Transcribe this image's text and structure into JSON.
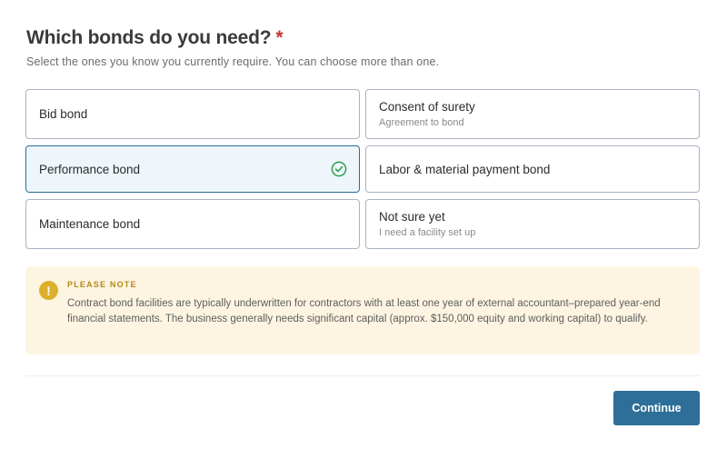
{
  "question": {
    "title": "Which bonds do you need?",
    "required_mark": "*",
    "subtitle": "Select the ones you know you currently require. You can choose more than one."
  },
  "options": [
    {
      "label": "Bid bond",
      "sub": "",
      "selected": false
    },
    {
      "label": "Consent of surety",
      "sub": "Agreement to bond",
      "selected": false
    },
    {
      "label": "Performance bond",
      "sub": "",
      "selected": true
    },
    {
      "label": "Labor & material payment bond",
      "sub": "",
      "selected": false
    },
    {
      "label": "Maintenance bond",
      "sub": "",
      "selected": false
    },
    {
      "label": "Not sure yet",
      "sub": "I need a facility set up",
      "selected": false
    }
  ],
  "note": {
    "icon": "exclamation-icon",
    "heading": "PLEASE NOTE",
    "body": "Contract bond facilities are typically underwritten for contractors with at least one year of external accountant–prepared year-end financial statements. The business generally needs significant capital (approx. $150,000 equity and working capital) to qualify."
  },
  "actions": {
    "continue_label": "Continue"
  },
  "colors": {
    "accent": "#2d6f98",
    "selected_bg": "#eef6fb",
    "check": "#2e9e4a",
    "note_bg": "#fdf5e1",
    "note_icon": "#ddb02b",
    "required": "#c0392b"
  }
}
